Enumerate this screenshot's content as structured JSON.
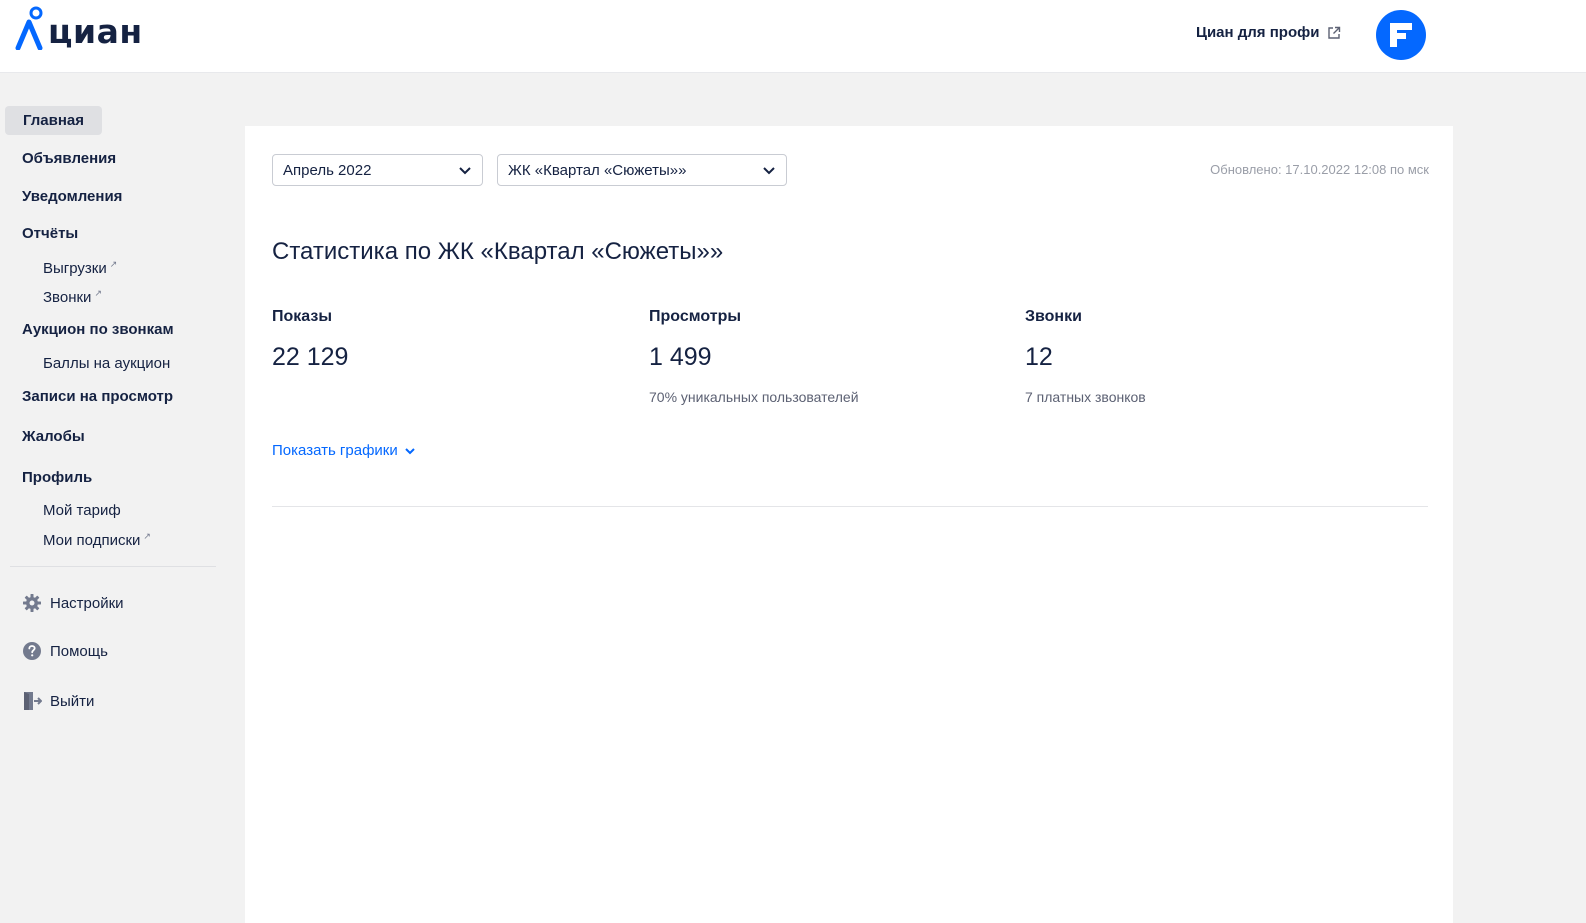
{
  "header": {
    "logo_text": "циан",
    "profi_link": "Циан для профи",
    "avatar_letter": "F"
  },
  "sidebar": {
    "items": [
      {
        "label": "Главная",
        "active": true
      },
      {
        "label": "Объявления"
      },
      {
        "label": "Уведомления"
      },
      {
        "label": "Отчёты"
      },
      {
        "label": "Выгрузки",
        "sub": true,
        "external": "↗"
      },
      {
        "label": "Звонки",
        "sub": true,
        "external": "↗"
      },
      {
        "label": "Аукцион по звонкам"
      },
      {
        "label": "Баллы на аукцион",
        "sub": true
      },
      {
        "label": "Записи на просмотр"
      },
      {
        "label": "Жалобы"
      },
      {
        "label": "Профиль"
      },
      {
        "label": "Мой тариф",
        "sub": true
      },
      {
        "label": "Мои подписки",
        "sub": true,
        "external": "↗"
      }
    ],
    "tools": [
      {
        "label": "Настройки",
        "icon": "gear-icon"
      },
      {
        "label": "Помощь",
        "icon": "help-icon"
      },
      {
        "label": "Выйти",
        "icon": "logout-icon"
      }
    ]
  },
  "filters": {
    "period": "Апрель 2022",
    "complex": "ЖК «Квартал «Сюжеты»»",
    "updated": "Обновлено: 17.10.2022 12:08 по мск"
  },
  "stats": {
    "title": "Статистика по ЖК «Квартал «Сюжеты»»",
    "items": [
      {
        "label": "Показы",
        "value": "22 129",
        "note": ""
      },
      {
        "label": "Просмотры",
        "value": "1 499",
        "note": "70% уникальных пользователей"
      },
      {
        "label": "Звонки",
        "value": "12",
        "note": "7 платных звонков"
      }
    ],
    "toggle_label": "Показать графики"
  },
  "colors": {
    "brand_blue": "#0468ff",
    "text_dark": "#152242",
    "background": "#f2f2f2"
  }
}
